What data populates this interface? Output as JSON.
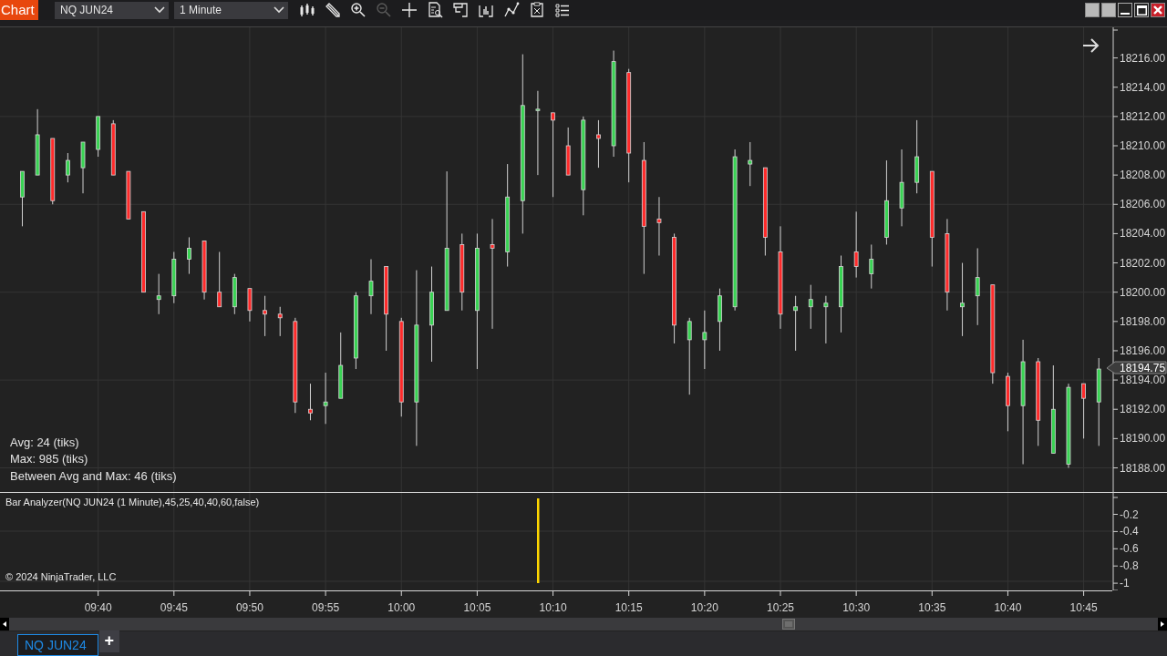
{
  "toolbar": {
    "title": "Chart",
    "instrument": "NQ JUN24",
    "interval": "1 Minute",
    "tools": [
      {
        "kind": "candles",
        "disabled": false
      },
      {
        "kind": "pencil",
        "disabled": false
      },
      {
        "kind": "zoom-in",
        "disabled": false
      },
      {
        "kind": "zoom-out",
        "disabled": true
      },
      {
        "kind": "crosshair",
        "disabled": false
      },
      {
        "kind": "doc-search",
        "disabled": false
      },
      {
        "kind": "panel",
        "disabled": false
      },
      {
        "kind": "bar-chart",
        "disabled": false
      },
      {
        "kind": "line-chart",
        "disabled": false
      },
      {
        "kind": "doc",
        "disabled": false
      },
      {
        "kind": "list",
        "disabled": false
      }
    ],
    "window_controls": [
      {
        "kind": "blank"
      },
      {
        "kind": "blank"
      },
      {
        "kind": "minimize"
      },
      {
        "kind": "maximize"
      },
      {
        "kind": "close"
      }
    ]
  },
  "price_panel": {
    "chart_data": {
      "type": "candlestick",
      "categories": [
        null,
        null,
        null,
        null,
        null,
        null,
        null,
        null,
        null,
        null,
        null,
        null,
        null,
        null,
        null,
        null,
        null,
        null,
        null,
        null,
        null,
        null,
        null,
        null,
        null,
        null,
        null,
        null,
        null,
        null,
        null,
        null,
        null,
        null,
        null,
        null,
        null,
        null,
        null,
        null,
        null,
        null,
        null,
        null,
        null,
        null,
        null,
        null,
        null,
        null,
        null,
        null,
        null,
        null,
        null,
        null,
        null,
        null,
        null,
        null,
        null,
        null,
        null,
        null,
        null,
        null,
        null,
        null,
        null,
        null,
        null,
        null
      ],
      "ylim": [
        18179.63,
        18218.09
      ],
      "grid": true,
      "yticks": [
        {
          "value": 18216,
          "label": "18216.00"
        },
        {
          "value": 18214,
          "label": "18214.00"
        },
        {
          "value": 18212,
          "label": "18212.00"
        },
        {
          "value": 18210,
          "label": "18210.00"
        },
        {
          "value": 18208,
          "label": "18208.00"
        },
        {
          "value": 18206,
          "label": "18206.00"
        },
        {
          "value": 18204,
          "label": "18204.00"
        },
        {
          "value": 18202,
          "label": "18202.00"
        },
        {
          "value": 18200,
          "label": "18200.00"
        },
        {
          "value": 18198,
          "label": "18198.00"
        },
        {
          "value": 18196,
          "label": "18196.00"
        },
        {
          "value": 18194,
          "label": "18194.00"
        },
        {
          "value": 18192,
          "label": "18192.00"
        },
        {
          "value": 18190,
          "label": "18190.00"
        },
        {
          "value": 18188,
          "label": "18188.00"
        }
      ],
      "ohlc": [
        [
          18206.5,
          18208.25,
          18204.5,
          18208.25
        ],
        [
          18208,
          18212.5,
          18208,
          18210.75
        ],
        [
          18210.5,
          18210.5,
          18206,
          18206.25
        ],
        [
          18208,
          18209.5,
          18207.5,
          18209
        ],
        [
          18208.5,
          18210.25,
          18206.75,
          18210.25
        ],
        [
          18209.75,
          18212,
          18209.25,
          18212
        ],
        [
          18211.5,
          18211.75,
          18208,
          18208
        ],
        [
          18208.25,
          18208.25,
          18205,
          18205
        ],
        [
          18205.5,
          18205.5,
          18200,
          18200
        ],
        [
          18199.5,
          18201.25,
          18198.5,
          18199.75
        ],
        [
          18199.75,
          18202.75,
          18199.25,
          18202.25
        ],
        [
          18202.25,
          18203.75,
          18201.25,
          18203
        ],
        [
          18203.5,
          18203.5,
          18199.5,
          18200
        ],
        [
          18200,
          18202.75,
          18199,
          18199
        ],
        [
          18199,
          18201.25,
          18198.5,
          18201
        ],
        [
          18200.25,
          18200.25,
          18198,
          18198.75
        ],
        [
          18198.75,
          18199.75,
          18197,
          18198.5
        ],
        [
          18198.5,
          18199,
          18197,
          18198.25
        ],
        [
          18198,
          18198.25,
          18191.75,
          18192.5
        ],
        [
          18192,
          18193.75,
          18191.25,
          18191.75
        ],
        [
          18192.25,
          18194.5,
          18191,
          18192.5
        ],
        [
          18192.75,
          18197.25,
          18192.75,
          18195
        ],
        [
          18195.5,
          18200,
          18194.75,
          18199.75
        ],
        [
          18199.75,
          18202.25,
          18198.5,
          18200.75
        ],
        [
          18201.75,
          18201.75,
          18196,
          18198.5
        ],
        [
          18198,
          18198.25,
          18191.5,
          18192.5
        ],
        [
          18192.5,
          18201.5,
          18189.5,
          18197.75
        ],
        [
          18197.75,
          18201.75,
          18195.25,
          18200
        ],
        [
          18198.75,
          18208.25,
          18198.75,
          18203
        ],
        [
          18203.25,
          18204,
          18198.75,
          18200
        ],
        [
          18198.75,
          18204,
          18194.75,
          18203
        ],
        [
          18203.25,
          18205,
          18197.5,
          18203
        ],
        [
          18202.75,
          18208.75,
          18201.75,
          18206.5
        ],
        [
          18206.25,
          18216.25,
          18204,
          18212.75
        ],
        [
          18212.5,
          18213.75,
          18208,
          18212.5
        ],
        [
          18212.25,
          18212.25,
          18206.5,
          18211.75
        ],
        [
          18210,
          18211.25,
          18208,
          18208
        ],
        [
          18207,
          18212,
          18205.25,
          18211.75
        ],
        [
          18210.75,
          18211.75,
          18208.5,
          18210.5
        ],
        [
          18210,
          18216.5,
          18209.25,
          18215.75
        ],
        [
          18215,
          18215.25,
          18207.5,
          18209.5
        ],
        [
          18209,
          18210.25,
          18201.25,
          18204.5
        ],
        [
          18205,
          18206.5,
          18202.5,
          18204.75
        ],
        [
          18203.75,
          18204,
          18196.5,
          18197.75
        ],
        [
          18196.75,
          18198.25,
          18193,
          18198
        ],
        [
          18196.75,
          18198.75,
          18194.75,
          18197.25
        ],
        [
          18198,
          18200.25,
          18196,
          18199.75
        ],
        [
          18199,
          18209.75,
          18198.75,
          18209.25
        ],
        [
          18208.75,
          18210.25,
          18207.25,
          18209
        ],
        [
          18208.5,
          18208.5,
          18202.5,
          18203.75
        ],
        [
          18202.75,
          18204.5,
          18197.5,
          18198.5
        ],
        [
          18198.75,
          18199.75,
          18196,
          18199
        ],
        [
          18199,
          18200.5,
          18197.5,
          18199.5
        ],
        [
          18199,
          18199.75,
          18196.5,
          18199.25
        ],
        [
          18199,
          18202.5,
          18197.25,
          18201.75
        ],
        [
          18202.75,
          18205.5,
          18201,
          18201.75
        ],
        [
          18201.25,
          18203.25,
          18200.25,
          18202.25
        ],
        [
          18203.75,
          18209,
          18203.25,
          18206.25
        ],
        [
          18205.75,
          18209.75,
          18204.5,
          18207.5
        ],
        [
          18207.5,
          18211.75,
          18206.75,
          18209.25
        ],
        [
          18208.25,
          18208.25,
          18201.75,
          18203.75
        ],
        [
          18204,
          18205,
          18198.75,
          18200
        ],
        [
          18199,
          18202,
          18197,
          18199.25
        ],
        [
          18199.75,
          18203,
          18197.75,
          18201
        ],
        [
          18200.5,
          18200.5,
          18193.75,
          18194.5
        ],
        [
          18194.25,
          18194.5,
          18190.5,
          18192.25
        ],
        [
          18192.25,
          18196.75,
          18188.25,
          18195.25
        ],
        [
          18195.25,
          18195.5,
          18189.5,
          18191.25
        ],
        [
          18189,
          18195,
          18189,
          18192
        ],
        [
          18188.25,
          18193.75,
          18188,
          18193.5
        ],
        [
          18193.75,
          18193.75,
          18190,
          18192.75
        ],
        [
          18192.5,
          18195.5,
          18189.5,
          18194.75
        ]
      ]
    },
    "stats": [
      "Avg: 24 (tiks)",
      "Max: 985 (tiks)",
      "Between Avg and Max: 46 (tiks)"
    ],
    "last_price": "18194.75"
  },
  "indicator_panel": {
    "label": "Bar Analyzer(NQ JUN24 (1 Minute),45,25,40,40,60,false)",
    "copyright": "© 2024 NinjaTrader, LLC",
    "axis": [
      "-0.2",
      "-0.4",
      "-0.6",
      "-0.8",
      "-1"
    ]
  },
  "time_axis": [
    "09:40",
    "09:45",
    "09:50",
    "09:55",
    "10:00",
    "10:05",
    "10:10",
    "10:15",
    "10:20",
    "10:25",
    "10:30",
    "10:35",
    "10:40",
    "10:45"
  ],
  "tabs": [
    {
      "label": "NQ JUN24",
      "selected": true
    }
  ],
  "new_tab": "+"
}
